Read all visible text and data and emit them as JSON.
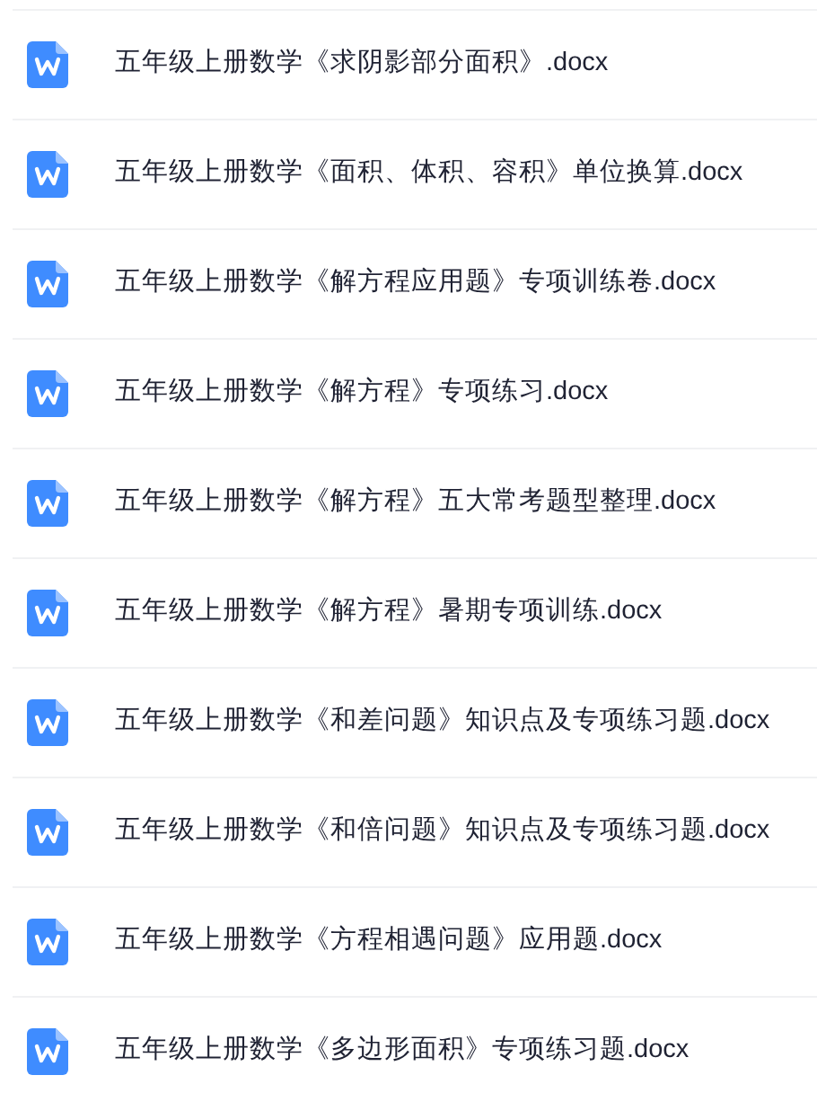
{
  "files": [
    {
      "name": "五年级上册数学《求阴影部分面积》.docx"
    },
    {
      "name": "五年级上册数学《面积、体积、容积》单位换算.docx"
    },
    {
      "name": "五年级上册数学《解方程应用题》专项训练卷.docx"
    },
    {
      "name": "五年级上册数学《解方程》专项练习.docx"
    },
    {
      "name": "五年级上册数学《解方程》五大常考题型整理.docx"
    },
    {
      "name": "五年级上册数学《解方程》暑期专项训练.docx"
    },
    {
      "name": "五年级上册数学《和差问题》知识点及专项练习题.docx"
    },
    {
      "name": "五年级上册数学《和倍问题》知识点及专项练习题.docx"
    },
    {
      "name": "五年级上册数学《方程相遇问题》应用题.docx"
    },
    {
      "name": "五年级上册数学《多边形面积》专项练习题.docx"
    }
  ]
}
